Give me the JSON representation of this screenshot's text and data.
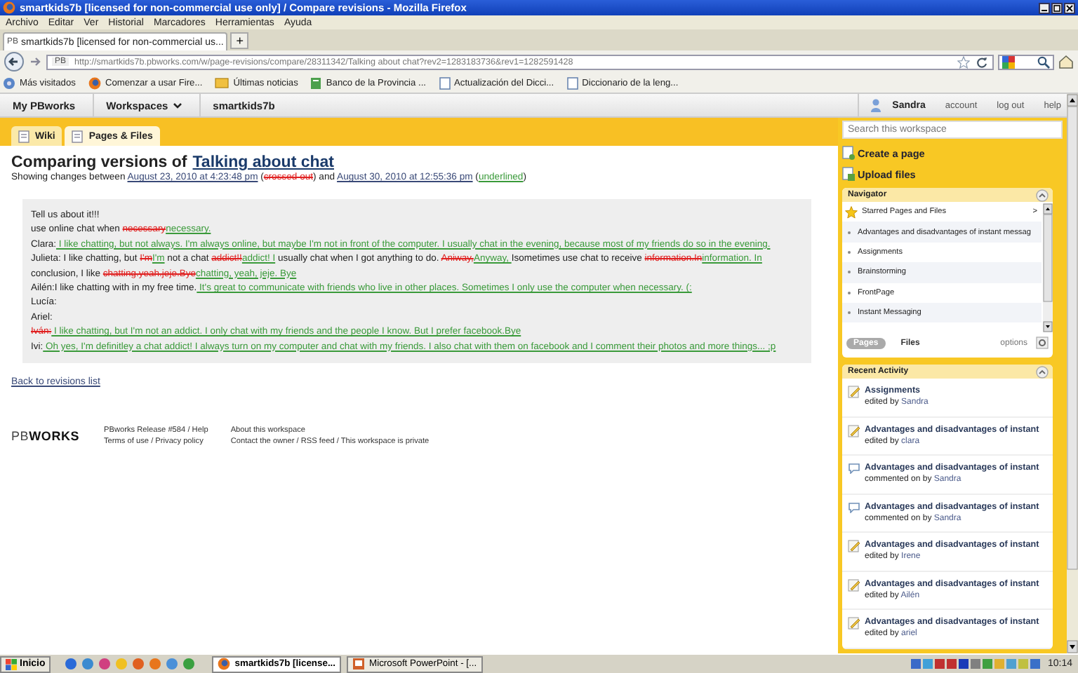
{
  "browser": {
    "title": "smartkids7b [licensed for non-commercial use only] / Compare revisions - Mozilla Firefox",
    "menu": [
      "Archivo",
      "Editar",
      "Ver",
      "Historial",
      "Marcadores",
      "Herramientas",
      "Ayuda"
    ],
    "tabs": [
      {
        "label": "smartkids7b [licensed for non-commercial us...",
        "selected": true
      }
    ],
    "new_tab": "+",
    "tab_badge": "PB",
    "url_badge": "PB",
    "url": "http://smartkids7b.pbworks.com/w/page-revisions/compare/28311342/Talking about chat?rev2=1283183736&rev1=1282591428",
    "bookmarks": [
      "Más visitados",
      "Comenzar a usar Fire...",
      "Últimas noticias",
      "Banco de la Provincia ...",
      "Actualización del Dicci...",
      "Diccionario de la leng..."
    ]
  },
  "topbar": {
    "nav": [
      {
        "label": "My PBworks",
        "kind": "link"
      },
      {
        "label": "Workspaces",
        "kind": "menu"
      },
      {
        "label": "smartkids7b",
        "kind": "current"
      }
    ],
    "user": "Sandra",
    "links": [
      "account",
      "log out",
      "help"
    ]
  },
  "wiki_tabs": [
    {
      "label": "Wiki",
      "selected": false
    },
    {
      "label": "Pages & Files",
      "selected": true
    }
  ],
  "search": {
    "placeholder": "Search this workspace"
  },
  "heading": {
    "prefix": "Comparing versions of",
    "link": "Talking about chat"
  },
  "subtitle": [
    {
      "kind": "text",
      "text": "Showing changes between "
    },
    {
      "kind": "link",
      "text": "August 23, 2010 at 4:23:48 pm"
    },
    {
      "kind": "text",
      "text": " ("
    },
    {
      "kind": "del",
      "text": "crossed out"
    },
    {
      "kind": "text",
      "text": ") and "
    },
    {
      "kind": "link",
      "text": "August 30, 2010 at 12:55:36 pm"
    },
    {
      "kind": "text",
      "text": " ("
    },
    {
      "kind": "ins",
      "text": "underlined"
    },
    {
      "kind": "text",
      "text": ")"
    }
  ],
  "diff": [
    [
      {
        "kind": "text",
        "text": "Tell us about it!!!"
      }
    ],
    [
      {
        "kind": "text",
        "text": "use online chat when "
      },
      {
        "kind": "del",
        "text": "necessary"
      },
      {
        "kind": "ins",
        "text": "necessary."
      }
    ],
    [
      {
        "kind": "text",
        "text": "Clara:"
      },
      {
        "kind": "ins",
        "text": " I like chatting, but not always. I'm always online, but maybe I'm not in front of the computer. I usually chat in the evening, because most of my friends do so in the evening."
      }
    ],
    [
      {
        "kind": "text",
        "text": "Julieta: I like chatting, but "
      },
      {
        "kind": "del",
        "text": "I'm"
      },
      {
        "kind": "ins",
        "text": "I'm"
      },
      {
        "kind": "text",
        "text": " not a chat "
      },
      {
        "kind": "del",
        "text": "addict!!"
      },
      {
        "kind": "ins",
        "text": "addict! I"
      },
      {
        "kind": "text",
        "text": " usually chat when I got anything to do. "
      },
      {
        "kind": "del",
        "text": "Aniway,"
      },
      {
        "kind": "ins",
        "text": "Anyway, "
      },
      {
        "kind": "text",
        "text": " Isometimes use chat to receive "
      },
      {
        "kind": "del",
        "text": "information.In"
      },
      {
        "kind": "ins",
        "text": "information. In"
      },
      {
        "kind": "text",
        "text": " conclusion, I like "
      },
      {
        "kind": "del",
        "text": "chatting.yeah.jeje.Bye"
      },
      {
        "kind": "ins",
        "text": "chatting, yeah, jeje. Bye"
      }
    ],
    [
      {
        "kind": "text",
        "text": "Ailén:I like chatting with in my free time."
      },
      {
        "kind": "ins",
        "text": " It's great to communicate with friends who live in other places. Sometimes I only use the computer when necessary. (:"
      }
    ],
    [
      {
        "kind": "text",
        "text": "Lucía:"
      }
    ],
    [
      {
        "kind": "text",
        "text": "Ariel:"
      }
    ],
    [
      {
        "kind": "del",
        "text": "Iván:"
      },
      {
        "kind": "ins",
        "text": " I like chatting, but I'm not an addict. I only chat with my friends and the people I know. But I prefer facebook.Bye"
      }
    ],
    [
      {
        "kind": "text",
        "text": "Ivi:"
      },
      {
        "kind": "ins",
        "text": " Oh yes, I'm definitley a chat addict! I always turn on my computer and chat with my friends. I also chat with them on facebook and I comment their photos and more things... ;p"
      }
    ]
  ],
  "back_link": "Back to revisions list",
  "footer": {
    "logo_light": "PB",
    "logo_bold": "WORKS",
    "col1": [
      "PBworks Release #584 / Help",
      "Terms of use / Privacy policy"
    ],
    "col2": [
      "About this workspace",
      "Contact the owner / RSS feed / This workspace is private"
    ]
  },
  "actions": [
    "Create a page",
    "Upload files"
  ],
  "navigator": {
    "title": "Navigator",
    "starred": "Starred Pages and Files",
    "more": ">",
    "items": [
      "Advantages and disadvantages of instant messag",
      "Assignments",
      "Brainstorming",
      "FrontPage",
      "Instant Messaging"
    ],
    "tabs": [
      {
        "label": "Pages",
        "selected": true
      },
      {
        "label": "Files",
        "selected": false
      }
    ],
    "options": "options"
  },
  "recent": {
    "title": "Recent Activity",
    "items": [
      {
        "kind": "edit",
        "title": "Assignments",
        "action": "edited by",
        "user": "Sandra"
      },
      {
        "kind": "edit",
        "title": "Advantages and disadvantages of instant",
        "action": "edited by",
        "user": "clara"
      },
      {
        "kind": "comment",
        "title": "Advantages and disadvantages of instant",
        "action": "commented on by",
        "user": "Sandra"
      },
      {
        "kind": "comment",
        "title": "Advantages and disadvantages of instant",
        "action": "commented on by",
        "user": "Sandra"
      },
      {
        "kind": "edit",
        "title": "Advantages and disadvantages of instant",
        "action": "edited by",
        "user": "Irene"
      },
      {
        "kind": "edit",
        "title": "Advantages and disadvantages of instant",
        "action": "edited by",
        "user": "Ailén"
      },
      {
        "kind": "edit",
        "title": "Advantages and disadvantages of instant",
        "action": "edited by",
        "user": "ariel"
      }
    ]
  },
  "taskbar": {
    "start": "Inicio",
    "tasks": [
      {
        "label": "smartkids7b [license...",
        "selected": true
      },
      {
        "label": "Microsoft PowerPoint - [...",
        "selected": false
      }
    ],
    "clock": "10:14"
  }
}
